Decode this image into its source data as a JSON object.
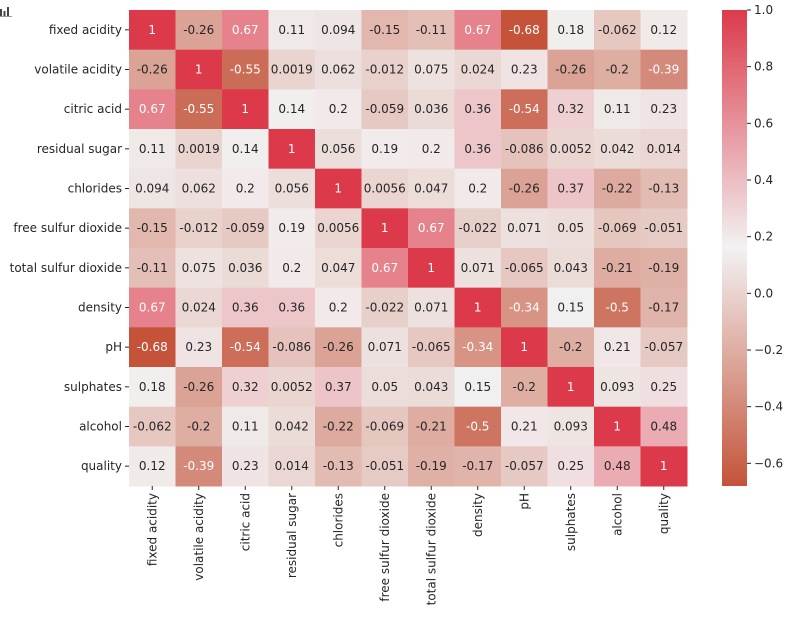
{
  "toolbar": {
    "icon": "bar-chart-icon"
  },
  "chart_data": {
    "type": "heatmap",
    "title": "",
    "xlabel": "",
    "ylabel": "",
    "annotated": true,
    "labels": [
      "fixed acidity",
      "volatile acidity",
      "citric acid",
      "residual sugar",
      "chlorides",
      "free sulfur dioxide",
      "total sulfur dioxide",
      "density",
      "pH",
      "sulphates",
      "alcohol",
      "quality"
    ],
    "values": [
      [
        "1",
        "-0.26",
        "0.67",
        "0.11",
        "0.094",
        "-0.15",
        "-0.11",
        "0.67",
        "-0.68",
        "0.18",
        "-0.062",
        "0.12"
      ],
      [
        "-0.26",
        "1",
        "-0.55",
        "0.0019",
        "0.062",
        "-0.012",
        "0.075",
        "0.024",
        "0.23",
        "-0.26",
        "-0.2",
        "-0.39"
      ],
      [
        "0.67",
        "-0.55",
        "1",
        "0.14",
        "0.2",
        "-0.059",
        "0.036",
        "0.36",
        "-0.54",
        "0.32",
        "0.11",
        "0.23"
      ],
      [
        "0.11",
        "0.0019",
        "0.14",
        "1",
        "0.056",
        "0.19",
        "0.2",
        "0.36",
        "-0.086",
        "0.0052",
        "0.042",
        "0.014"
      ],
      [
        "0.094",
        "0.062",
        "0.2",
        "0.056",
        "1",
        "0.0056",
        "0.047",
        "0.2",
        "-0.26",
        "0.37",
        "-0.22",
        "-0.13"
      ],
      [
        "-0.15",
        "-0.012",
        "-0.059",
        "0.19",
        "0.0056",
        "1",
        "0.67",
        "-0.022",
        "0.071",
        "0.05",
        "-0.069",
        "-0.051"
      ],
      [
        "-0.11",
        "0.075",
        "0.036",
        "0.2",
        "0.047",
        "0.67",
        "1",
        "0.071",
        "-0.065",
        "0.043",
        "-0.21",
        "-0.19"
      ],
      [
        "0.67",
        "0.024",
        "0.36",
        "0.36",
        "0.2",
        "-0.022",
        "0.071",
        "1",
        "-0.34",
        "0.15",
        "-0.5",
        "-0.17"
      ],
      [
        "-0.68",
        "0.23",
        "-0.54",
        "-0.086",
        "-0.26",
        "0.071",
        "-0.065",
        "-0.34",
        "1",
        "-0.2",
        "0.21",
        "-0.057"
      ],
      [
        "0.18",
        "-0.26",
        "0.32",
        "0.0052",
        "0.37",
        "0.05",
        "0.043",
        "0.15",
        "-0.2",
        "1",
        "0.093",
        "0.25"
      ],
      [
        "-0.062",
        "-0.2",
        "0.11",
        "0.042",
        "-0.22",
        "-0.069",
        "-0.21",
        "-0.5",
        "0.21",
        "0.093",
        "1",
        "0.48"
      ],
      [
        "0.12",
        "-0.39",
        "0.23",
        "0.014",
        "-0.13",
        "-0.051",
        "-0.19",
        "-0.17",
        "-0.057",
        "0.25",
        "0.48",
        "1"
      ]
    ],
    "colorbar": {
      "vmin": -0.68,
      "vmax": 1.0,
      "ticks": [
        1.0,
        0.8,
        0.6,
        0.4,
        0.2,
        0.0,
        -0.2,
        -0.4,
        -0.6
      ],
      "tick_labels": [
        "1.0",
        "0.8",
        "0.6",
        "0.4",
        "0.2",
        "0.0",
        "−0.2",
        "−0.4",
        "−0.6"
      ],
      "placement": "right"
    },
    "colors": {
      "negative": "#c4533a",
      "center": "#f2f2f2",
      "positive": "#dc3a4a",
      "text_dark": "#262626",
      "text_light": "#ffffff"
    },
    "grid": false
  }
}
